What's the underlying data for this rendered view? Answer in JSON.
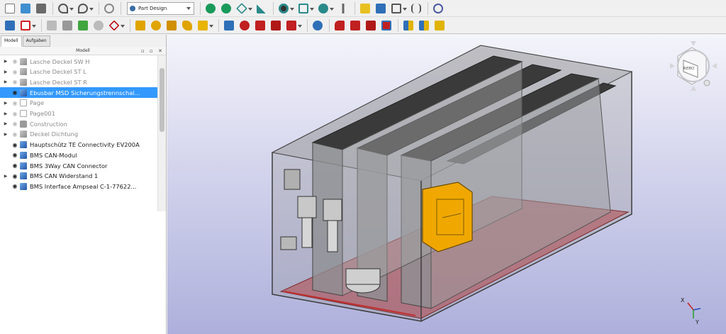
{
  "toolbar": {
    "workbench_label": "Part Design",
    "row1_icons": [
      "new-file-icon",
      "open-file-icon",
      "save-icon",
      "undo-icon",
      "redo-icon",
      "refresh-icon",
      "workbench-selector",
      "zoom-fit-all-icon",
      "zoom-fit-selection-icon",
      "view-isometric-icon",
      "view-measure-icon",
      "draw-style-icon",
      "standard-views-icon",
      "zoom-icon",
      "navigation-style-icon",
      "create-part-icon",
      "create-group-icon",
      "link-icon",
      "macro-icon",
      "whats-this-icon"
    ],
    "row2_icons": [
      "body-icon",
      "sketch-icon",
      "datum-plane-icon",
      "datum-line-icon",
      "datum-point-icon",
      "shape-binder-icon",
      "clone-icon",
      "pad-icon",
      "revolution-icon",
      "loft-icon",
      "pipe-icon",
      "additive-helix-icon",
      "pocket-icon",
      "hole-icon",
      "groove-icon",
      "subtractive-loft-icon",
      "subtractive-pipe-icon",
      "boolean-icon",
      "fillet-icon",
      "chamfer-icon",
      "draft-icon",
      "thickness-icon",
      "mirrored-icon",
      "linear-pattern-icon",
      "polar-pattern-icon"
    ]
  },
  "panel": {
    "tabs": [
      "Modell",
      "Aufgaben"
    ],
    "header": "Modell",
    "items": [
      {
        "label": "Lasche Deckel SW H",
        "dim": true,
        "expander": true,
        "icon": "grey"
      },
      {
        "label": "Lasche Deckel ST L",
        "dim": true,
        "expander": true,
        "icon": "grey"
      },
      {
        "label": "Lasche Deckel ST R",
        "dim": true,
        "expander": true,
        "icon": "grey"
      },
      {
        "label": "Ebusbar MSD Sicherungstrennschal...",
        "dim": false,
        "expander": false,
        "icon": "body",
        "selected": true
      },
      {
        "label": "Page",
        "dim": true,
        "expander": true,
        "icon": "page"
      },
      {
        "label": "Page001",
        "dim": true,
        "expander": true,
        "icon": "page"
      },
      {
        "label": "Construction",
        "dim": true,
        "expander": true,
        "icon": "folder"
      },
      {
        "label": "Deckel Dichtung",
        "dim": true,
        "expander": true,
        "icon": "grey"
      },
      {
        "label": "Hauptschütz TE Connectivity EV200A",
        "dim": false,
        "expander": false,
        "icon": "body"
      },
      {
        "label": "BMS CAN-Modul",
        "dim": false,
        "expander": false,
        "icon": "body"
      },
      {
        "label": "BMS 3Way CAN Connector",
        "dim": false,
        "expander": false,
        "icon": "body"
      },
      {
        "label": "BMS CAN Widerstand 1",
        "dim": false,
        "expander": true,
        "icon": "body"
      },
      {
        "label": "BMS Interface Ampseal C-1-77622...",
        "dim": false,
        "expander": false,
        "icon": "body"
      }
    ]
  },
  "viewport": {
    "navcube_face": "REBO",
    "axis_labels": [
      "X",
      "Y"
    ],
    "colors": {
      "selection": "#3399ff",
      "highlight_part": "#f0a800",
      "enclosure": "#8a8c8e",
      "module_top": "#3c3c3c",
      "floor": "#b04040"
    }
  }
}
